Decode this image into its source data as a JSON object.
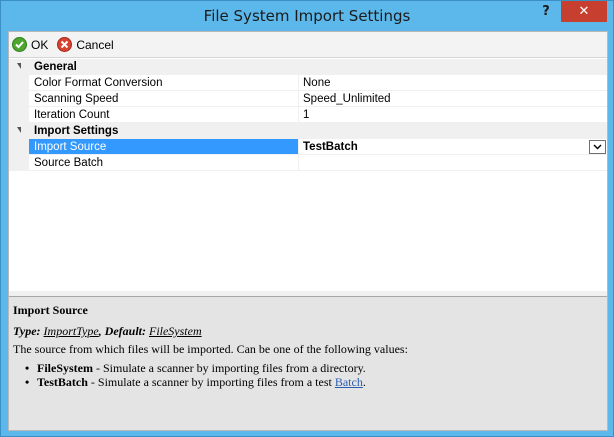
{
  "window": {
    "title": "File System Import Settings",
    "help_glyph": "?",
    "close_glyph": "✕"
  },
  "toolbar": {
    "ok_label": "OK",
    "cancel_label": "Cancel"
  },
  "grid": {
    "categories": [
      {
        "label": "General",
        "properties": [
          {
            "name": "Color Format Conversion",
            "value": "None"
          },
          {
            "name": "Scanning Speed",
            "value": "Speed_Unlimited"
          },
          {
            "name": "Iteration Count",
            "value": "1"
          }
        ]
      },
      {
        "label": "Import Settings",
        "properties": [
          {
            "name": "Import Source",
            "value": "TestBatch",
            "selected": true
          },
          {
            "name": "Source Batch",
            "value": ""
          }
        ]
      }
    ]
  },
  "help": {
    "title": "Import Source",
    "type_prefix": "Type: ",
    "type_value": "ImportType",
    "default_prefix": ", Default: ",
    "default_value": "FileSystem",
    "description": "The source from which files will be imported. Can be one of the following values:",
    "items": [
      {
        "term": "FileSystem",
        "text": " - Simulate a scanner by importing files from a directory."
      },
      {
        "term": "TestBatch",
        "text": " - Simulate a scanner by importing files from a test ",
        "link": "Batch",
        "suffix": "."
      }
    ]
  },
  "colors": {
    "titlebar": "#5cb8ea",
    "selection": "#3399ff",
    "close": "#c7402f"
  }
}
